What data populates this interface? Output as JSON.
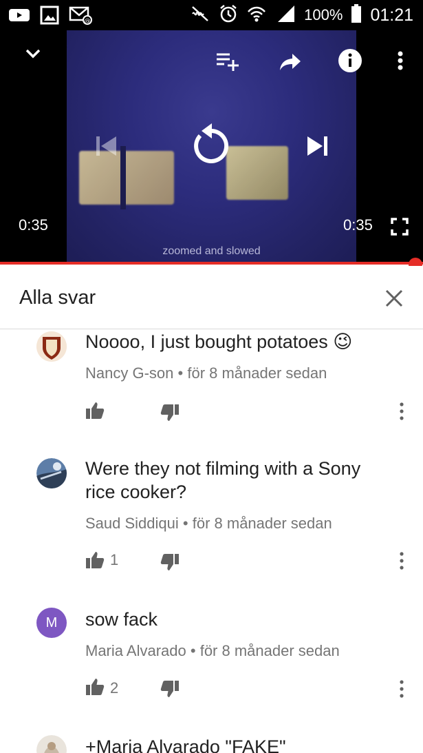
{
  "status_bar": {
    "battery": "100%",
    "time": "01:21",
    "icons": [
      "youtube-icon",
      "gallery-icon",
      "email-icon",
      "mute-icon",
      "alarm-icon",
      "wifi-icon",
      "signal-icon",
      "battery-icon"
    ]
  },
  "player": {
    "time_elapsed": "0:35",
    "time_total": "0:35",
    "caption": "zoomed and slowed",
    "progress": 1.0,
    "accent_color": "#e52d27"
  },
  "replies": {
    "title": "Alla svar"
  },
  "comments": [
    {
      "text": "Noooo, I just bought potatoes",
      "emoji": "😉",
      "author": "Nancy G-son",
      "time": "för 8 månader sedan",
      "likes": ""
    },
    {
      "text": "Were they not filming with a Sony rice cooker?",
      "author": "Saud Siddiqui",
      "time": "för 8 månader sedan",
      "likes": "1"
    },
    {
      "text": "sow fack",
      "author": "Maria Alvarado",
      "time": "för 8 månader sedan",
      "likes": "2",
      "avatar_letter": "M",
      "avatar_color": "#7e57c2"
    },
    {
      "text": "+Maria Alvarado \"FAKE\""
    }
  ],
  "meta_separator": "•"
}
